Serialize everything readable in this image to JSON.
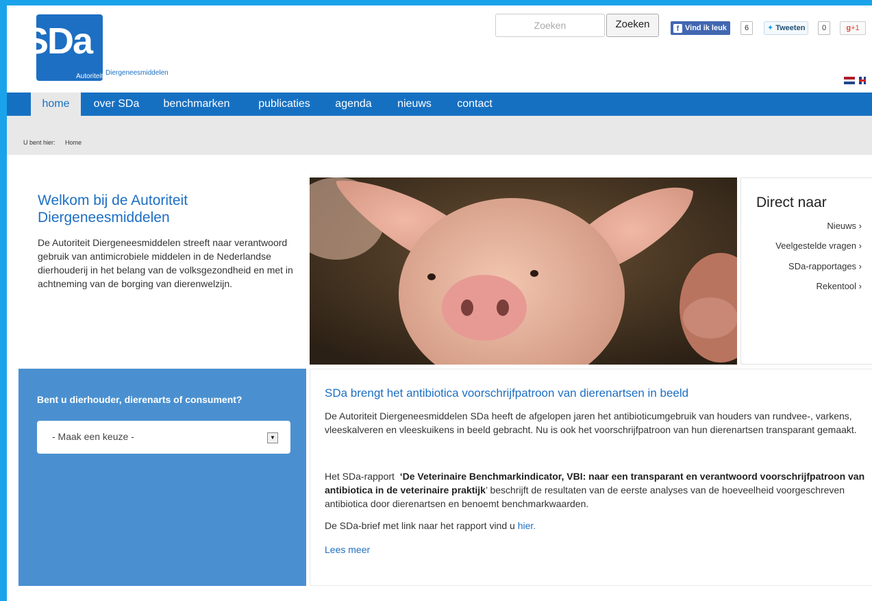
{
  "header": {
    "logo_abbrev": "SDa",
    "logo_word1": "Autoriteit",
    "logo_word2": "Diergeneesmiddelen",
    "search_placeholder": "Zoeken",
    "search_button": "Zoeken",
    "fb_like": "Vind ik leuk",
    "fb_count": "6",
    "tweet": "Tweeten",
    "tweet_count": "0",
    "gplus": "+1"
  },
  "nav": {
    "items": [
      "home",
      "over SDa",
      "benchmarken",
      "publicaties",
      "agenda",
      "nieuws",
      "contact"
    ],
    "active": "home"
  },
  "breadcrumb": {
    "prefix": "U bent hier:",
    "current": "Home"
  },
  "welcome": {
    "title": "Welkom bij de Autoriteit Diergeneesmiddelen",
    "text": "De Autoriteit Diergeneesmiddelen streeft naar verantwoord gebruik van antimicrobiele middelen in de Nederlandse dierhouderij in het belang van de volksgezondheid en met in achtneming van de borging van dierenwelzijn."
  },
  "direct": {
    "title": "Direct naar",
    "links": [
      "Nieuws ›",
      "Veelgestelde vragen ›",
      "SDa-rapportages ›",
      "Rekentool ›"
    ]
  },
  "chooser": {
    "question": "Bent u dierhouder, dierenarts of consument?",
    "selected": "- Maak een keuze -"
  },
  "article": {
    "title": "SDa brengt het antibiotica voorschrijfpatroon van dierenartsen in beeld",
    "p1": "De Autoriteit Diergeneesmiddelen SDa heeft de afgelopen jaren het antibioticumgebruik van houders van rundvee-, varkens, vleeskalveren en vleeskuikens in beeld gebracht. Nu is ook het voorschrijfpatroon van hun dierenartsen transparant gemaakt.",
    "p2_before": "Het SDa-rapport",
    "p2_bold": "‘De Veterinaire Benchmarkindicator, VBI: naar een transparant en verantwoord voorschrijfpatroon van antibiotica in de veterinaire praktijk",
    "p2_after": "’ beschrijft de resultaten van de eerste analyses van de hoeveelheid voorgeschreven antibiotica door dierenartsen en benoemt benchmarkwaarden.",
    "p3_before": "De SDa-brief met link naar het rapport vind u",
    "p3_link": "hier.",
    "read_more": "Lees meer"
  },
  "colors": {
    "frame": "#1aa3ea",
    "brand_blue": "#1670c2",
    "box_blue": "#4a90d0",
    "link_blue": "#1d6fc3"
  }
}
